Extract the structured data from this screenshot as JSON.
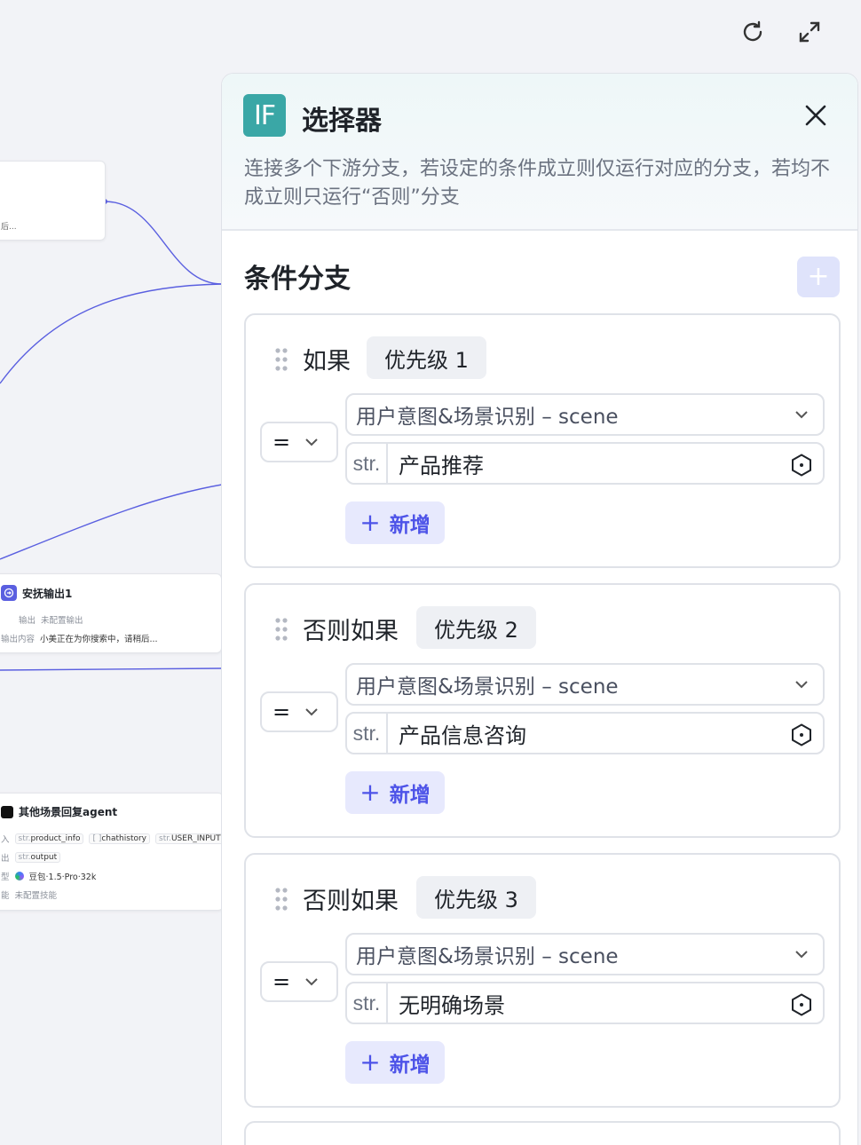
{
  "toolbar": {
    "refresh_icon": "refresh-icon",
    "expand_icon": "expand-icon"
  },
  "canvas": {
    "nodes": [
      {
        "snippet": "后..."
      },
      {
        "title": "安抚输出1",
        "rows": [
          {
            "label": "输出",
            "value": "未配置输出"
          },
          {
            "label": "输出内容",
            "value": "小美正在为你搜索中，请稍后..."
          }
        ]
      },
      {
        "title": "其他场景回复agent",
        "input_label": "入",
        "inputs": [
          {
            "prefix": "str.",
            "name": "product_info"
          },
          {
            "prefix": "[ ]",
            "name": "chathistory"
          },
          {
            "prefix": "str.",
            "name": "USER_INPUT"
          }
        ],
        "output_label": "出",
        "output": {
          "prefix": "str.",
          "name": "output"
        },
        "model_label": "型",
        "model": "豆包·1.5·Pro·32k",
        "skills_label": "能",
        "skills": "未配置技能"
      }
    ]
  },
  "panel": {
    "badge": "IF",
    "title": "选择器",
    "description": "连接多个下游分支，若设定的条件成立则仅运行对应的分支，若均不成立则只运行“否则”分支",
    "section_title": "条件分支",
    "add_branch_symbol": "+",
    "branches": [
      {
        "label": "如果",
        "priority": "优先级 1",
        "operator": "=",
        "variable": "用户意图&场景识别 – scene",
        "value_type": "str.",
        "value": "产品推荐",
        "add_label": "新增",
        "add_symbol": "+"
      },
      {
        "label": "否则如果",
        "priority": "优先级 2",
        "operator": "=",
        "variable": "用户意图&场景识别 – scene",
        "value_type": "str.",
        "value": "产品信息咨询",
        "add_label": "新增",
        "add_symbol": "+"
      },
      {
        "label": "否则如果",
        "priority": "优先级 3",
        "operator": "=",
        "variable": "用户意图&场景识别 – scene",
        "value_type": "str.",
        "value": "无明确场景",
        "add_label": "新增",
        "add_symbol": "+"
      }
    ]
  },
  "colors": {
    "accent": "#4d53e8",
    "badge": "#3aa7a6",
    "edge": "#5a5fe0"
  }
}
